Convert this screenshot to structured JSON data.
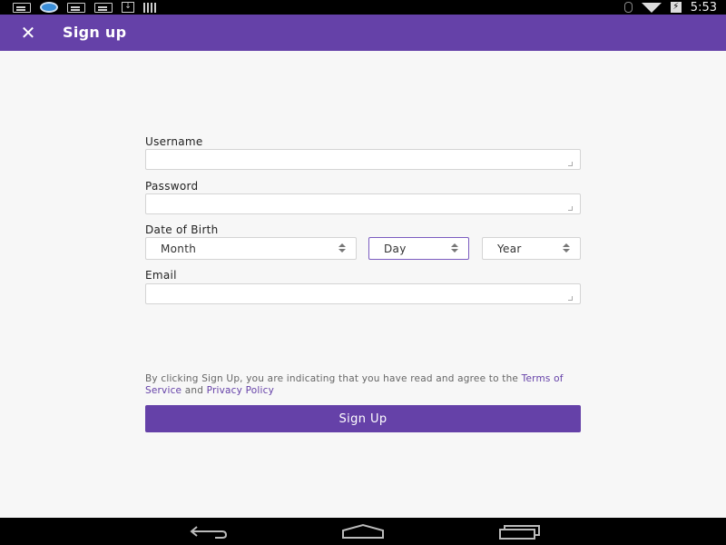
{
  "status_bar": {
    "time": "5:53",
    "left_icons": [
      "message-icon",
      "sync-icon",
      "message-icon",
      "message-icon",
      "download-icon",
      "barcode-icon"
    ],
    "right_icons": [
      "bluetooth-icon",
      "wifi-icon",
      "battery-charging-icon"
    ],
    "battery_glyph": "⚡"
  },
  "app_bar": {
    "title": "Sign up",
    "close_glyph": "✕",
    "color": "#6541a8"
  },
  "form": {
    "username": {
      "label": "Username",
      "value": "",
      "placeholder": ""
    },
    "password": {
      "label": "Password",
      "value": "",
      "placeholder": ""
    },
    "dob": {
      "label": "Date of Birth",
      "month": "Month",
      "day": "Day",
      "year": "Year"
    },
    "email": {
      "label": "Email",
      "value": "",
      "placeholder": ""
    }
  },
  "terms": {
    "text_before": "By clicking Sign Up, you are indicating that you have read and agree to the ",
    "tos_link": "Terms of Service",
    "and": " and ",
    "privacy_link": "Privacy Policy"
  },
  "signup_button": {
    "label": "Sign Up"
  },
  "nav_bar": {
    "buttons": [
      "back-icon",
      "home-icon",
      "recents-icon"
    ]
  }
}
